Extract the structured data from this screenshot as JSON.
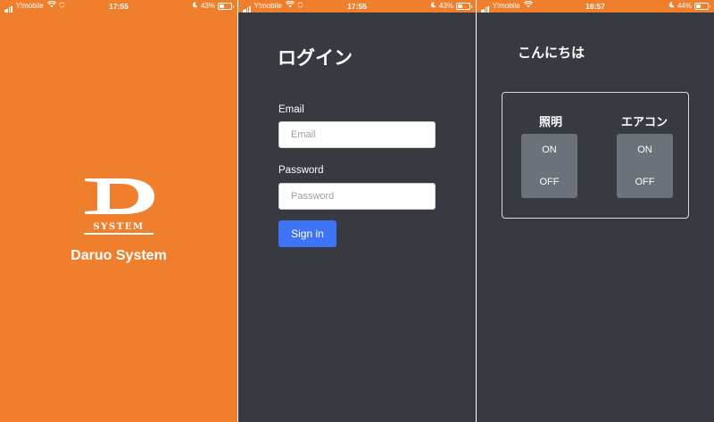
{
  "screens": [
    {
      "status": {
        "carrier": "Y!mobile",
        "time": "17:55",
        "battery": "43%",
        "battery_level": 0.43
      },
      "app_name": "Daruo System",
      "logo": {
        "letter": "D",
        "word": "SYSTEM"
      }
    },
    {
      "status": {
        "carrier": "Y!mobile",
        "time": "17:55",
        "battery": "43%",
        "battery_level": 0.43
      },
      "title": "ログイン",
      "email": {
        "label": "Email",
        "placeholder": "Email"
      },
      "password": {
        "label": "Password",
        "placeholder": "Password"
      },
      "submit": "Sign in"
    },
    {
      "status": {
        "carrier": "Y!mobile",
        "time": "16:57",
        "battery": "44%",
        "battery_level": 0.44
      },
      "greeting": "こんにちは",
      "controls": [
        {
          "label": "照明",
          "on": "ON",
          "off": "OFF"
        },
        {
          "label": "エアコン",
          "on": "ON",
          "off": "OFF"
        }
      ]
    }
  ],
  "colors": {
    "brand_orange": "#ef7f2d",
    "dark_bg": "#373a40",
    "primary_button": "#3f73f5",
    "toggle_group": "#6b727a"
  }
}
